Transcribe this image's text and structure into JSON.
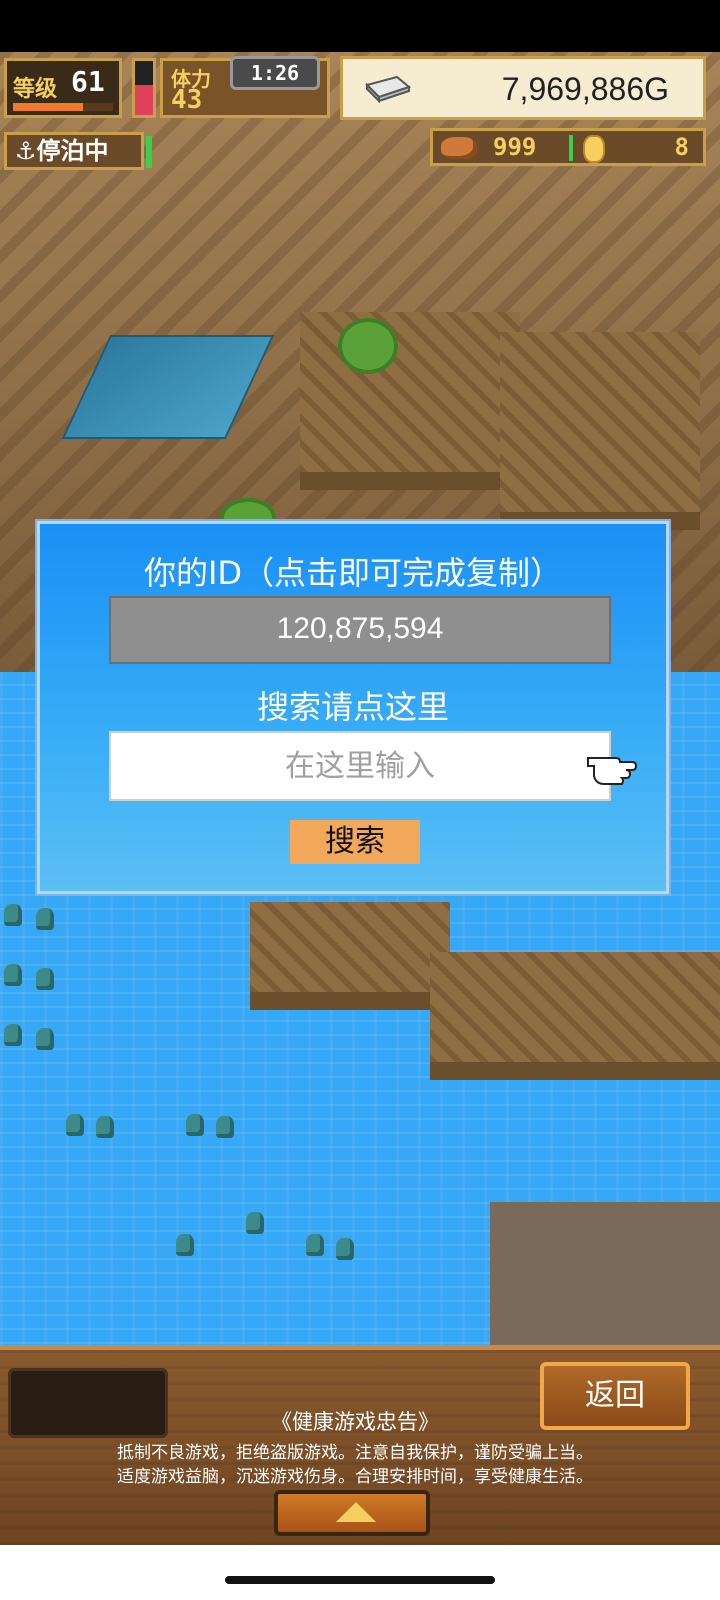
{
  "hud": {
    "level_label": "等级",
    "level_value": "61",
    "level_progress": 0.7,
    "stamina_label": "体力",
    "stamina_value": "43",
    "stamina_fill": 0.55,
    "timer": "1:26",
    "gold_value": "7,969,886G",
    "status_docked": "停泊中",
    "meat_count": "999",
    "coin_count": "8"
  },
  "dialog": {
    "title": "你的ID（点击即可完成复制）",
    "player_id": "120,875,594",
    "search_hint": "搜索请点这里",
    "search_placeholder": "在这里输入",
    "search_value": "",
    "search_button": "搜索"
  },
  "bottom": {
    "back_button": "返回",
    "advisory_title": "《健康游戏忠告》",
    "advisory_lines": [
      "抵制不良游戏，拒绝盗版游戏。注意自我保护，谨防受骗上当。",
      "适度游戏益脑，沉迷游戏伤身。合理安排时间，享受健康生活。"
    ]
  },
  "icons": {
    "anchor": "anchor-icon",
    "gold": "silver-bar-icon",
    "meat": "meat-icon",
    "coin": "coin-icon",
    "pointer": "pointing-hand-icon",
    "expand": "triangle-up-icon"
  },
  "colors": {
    "dialog_bg": "#1a90f6",
    "button_orange": "#f2a85a",
    "hud_gold_border": "#c9a04a",
    "water": "#36a8f5"
  }
}
